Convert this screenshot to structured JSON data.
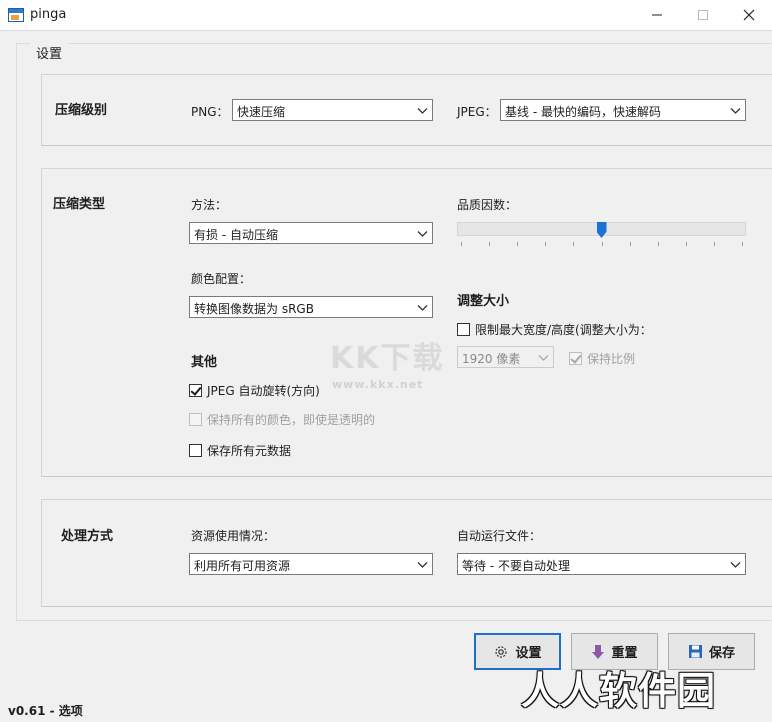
{
  "window": {
    "title": "pinga"
  },
  "settings_frame": {
    "label": "设置"
  },
  "compression_level": {
    "title": "压缩级别",
    "png_label": "PNG：",
    "png_value": "快速压缩",
    "jpeg_label": "JPEG：",
    "jpeg_value": "基线 - 最快的编码，快速解码"
  },
  "compression_type": {
    "title": "压缩类型",
    "method_label": "方法：",
    "method_value": "有损 - 自动压缩",
    "quality_label": "品质因数：",
    "quality_fraction": 0.5,
    "color_profile_label": "颜色配置：",
    "color_profile_value": "转换图像数据为 sRGB",
    "resize_title": "调整大小",
    "limit_size_label": "限制最大宽度/高度(调整大小为：",
    "limit_size_checked": false,
    "size_value": "1920 像素",
    "keep_ratio_label": "保持比例",
    "keep_ratio_checked": true,
    "other_title": "其他",
    "jpeg_autorotate_label": "JPEG 自动旋转(方向)",
    "jpeg_autorotate_checked": true,
    "keep_colors_label": "保持所有的颜色，即使是透明的",
    "keep_colors_checked": false,
    "keep_metadata_label": "保存所有元数据",
    "keep_metadata_checked": false
  },
  "processing": {
    "title": "处理方式",
    "resource_label": "资源使用情况：",
    "resource_value": "利用所有可用资源",
    "autorun_label": "自动运行文件：",
    "autorun_value": "等待 - 不要自动处理"
  },
  "buttons": {
    "settings": "设置",
    "reset": "重置",
    "save": "保存"
  },
  "status": {
    "text": "v0.61 - 选项"
  },
  "watermark": {
    "main": "KK下载",
    "sub": "www.kkx.net"
  },
  "brand": {
    "text": "人人软件园"
  },
  "icons": {
    "app": "pinga-app-icon",
    "settings": "gear-icon",
    "reset": "down-arrow-icon",
    "save": "floppy-disk-icon"
  },
  "colors": {
    "accent": "#1f6fc8",
    "slider": "#1a73d4"
  }
}
